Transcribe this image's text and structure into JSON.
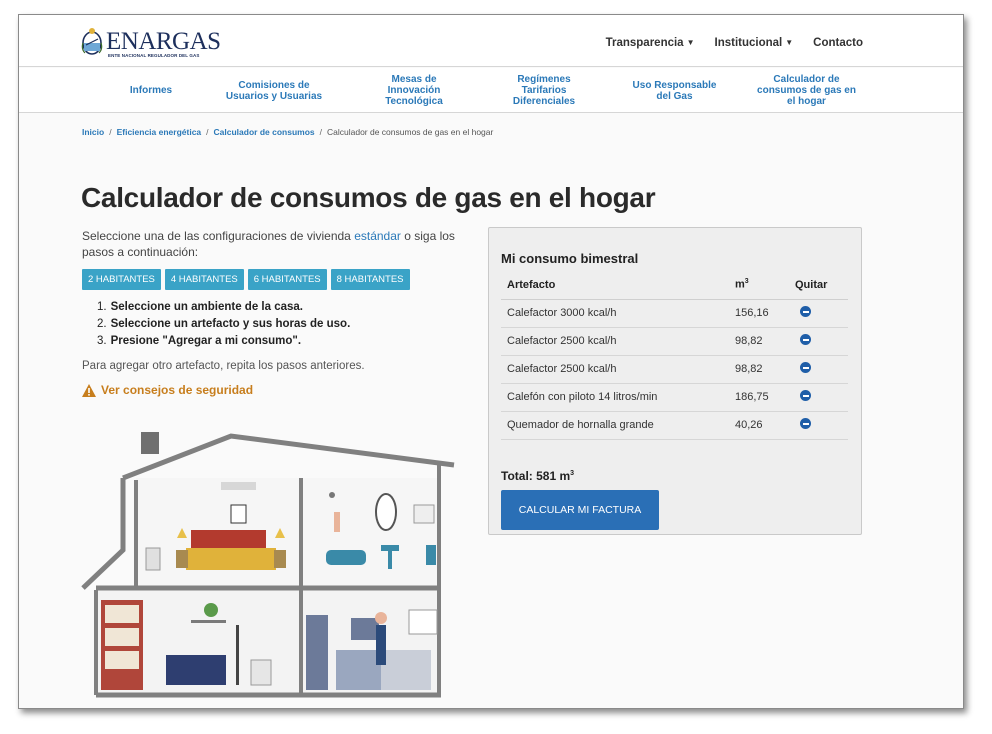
{
  "header": {
    "brand": "ENARGAS",
    "brand_sub": "ENTE NACIONAL REGULADOR DEL GAS",
    "top_nav": [
      {
        "label": "Transparencia",
        "dropdown": true
      },
      {
        "label": "Institucional",
        "dropdown": true
      },
      {
        "label": "Contacto",
        "dropdown": false
      }
    ]
  },
  "main_nav": [
    "Informes",
    "Comisiones de Usuarios y Usuarias",
    "Mesas de Innovación Tecnológica",
    "Regímenes Tarifarios Diferenciales",
    "Uso Responsable del Gas",
    "Calculador de consumos de gas en el hogar"
  ],
  "breadcrumb": {
    "items": [
      "Inicio",
      "Eficiencia energética",
      "Calculador de consumos"
    ],
    "current": "Calculador de consumos de gas en el hogar",
    "separator": "/"
  },
  "page": {
    "title": "Calculador de consumos de gas en el hogar",
    "intro_before": "Seleccione una de las configuraciones de vivienda ",
    "intro_link": "estándar",
    "intro_after": " o siga los pasos a continuación:",
    "habitantes": [
      "2 HABITANTES",
      "4 HABITANTES",
      "6 HABITANTES",
      "8 HABITANTES"
    ],
    "steps": [
      {
        "n": "1.",
        "text": "Seleccione un ambiente de la casa."
      },
      {
        "n": "2.",
        "text": "Seleccione un artefacto y sus horas de uso."
      },
      {
        "n": "3.",
        "text": "Presione \"Agregar a mi consumo\"."
      }
    ],
    "repeat_note": "Para agregar otro artefacto, repita los pasos anteriores.",
    "safety_link": "Ver consejos de seguridad"
  },
  "panel": {
    "title": "Mi consumo bimestral",
    "columns": {
      "artefacto": "Artefacto",
      "m3": "m",
      "m3_sup": "3",
      "quitar": "Quitar"
    },
    "rows": [
      {
        "artefacto": "Calefactor 3000 kcal/h",
        "m3": "156,16"
      },
      {
        "artefacto": "Calefactor 2500 kcal/h",
        "m3": "98,82"
      },
      {
        "artefacto": "Calefactor 2500 kcal/h",
        "m3": "98,82"
      },
      {
        "artefacto": "Calefón con piloto 14 litros/min",
        "m3": "186,75"
      },
      {
        "artefacto": "Quemador de hornalla grande",
        "m3": "40,26"
      }
    ],
    "total_label": "Total: 581 m",
    "total_sup": "3",
    "button": "CALCULAR MI FACTURA"
  },
  "colors": {
    "brand": "#1d2f5c",
    "link": "#2b79b8",
    "habitante_btn": "#3aa3c7",
    "primary_btn": "#2a6fb6",
    "warning": "#c77e1d"
  }
}
